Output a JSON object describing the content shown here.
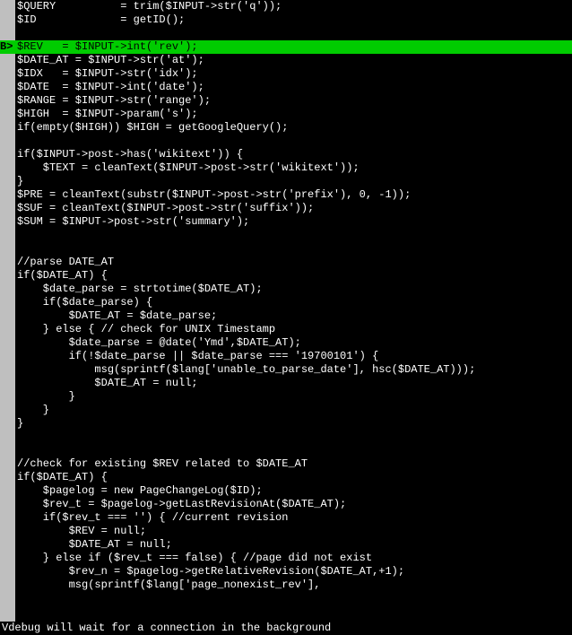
{
  "gutter": {
    "breakpoint_marker": "B>"
  },
  "breakpoint_line_index": 3,
  "status_line": "Vdebug will wait for a connection in the background",
  "code_lines": [
    "$QUERY          = trim($INPUT->str('q'));",
    "$ID             = getID();",
    "",
    "$REV   = $INPUT->int('rev');",
    "$DATE_AT = $INPUT->str('at');",
    "$IDX   = $INPUT->str('idx');",
    "$DATE  = $INPUT->int('date');",
    "$RANGE = $INPUT->str('range');",
    "$HIGH  = $INPUT->param('s');",
    "if(empty($HIGH)) $HIGH = getGoogleQuery();",
    "",
    "if($INPUT->post->has('wikitext')) {",
    "    $TEXT = cleanText($INPUT->post->str('wikitext'));",
    "}",
    "$PRE = cleanText(substr($INPUT->post->str('prefix'), 0, -1));",
    "$SUF = cleanText($INPUT->post->str('suffix'));",
    "$SUM = $INPUT->post->str('summary');",
    "",
    "",
    "//parse DATE_AT",
    "if($DATE_AT) {",
    "    $date_parse = strtotime($DATE_AT);",
    "    if($date_parse) {",
    "        $DATE_AT = $date_parse;",
    "    } else { // check for UNIX Timestamp",
    "        $date_parse = @date('Ymd',$DATE_AT);",
    "        if(!$date_parse || $date_parse === '19700101') {",
    "            msg(sprintf($lang['unable_to_parse_date'], hsc($DATE_AT)));",
    "            $DATE_AT = null;",
    "        }",
    "    }",
    "}",
    "",
    "",
    "//check for existing $REV related to $DATE_AT",
    "if($DATE_AT) {",
    "    $pagelog = new PageChangeLog($ID);",
    "    $rev_t = $pagelog->getLastRevisionAt($DATE_AT);",
    "    if($rev_t === '') { //current revision",
    "        $REV = null;",
    "        $DATE_AT = null;",
    "    } else if ($rev_t === false) { //page did not exist",
    "        $rev_n = $pagelog->getRelativeRevision($DATE_AT,+1);",
    "        msg(sprintf($lang['page_nonexist_rev'],"
  ]
}
